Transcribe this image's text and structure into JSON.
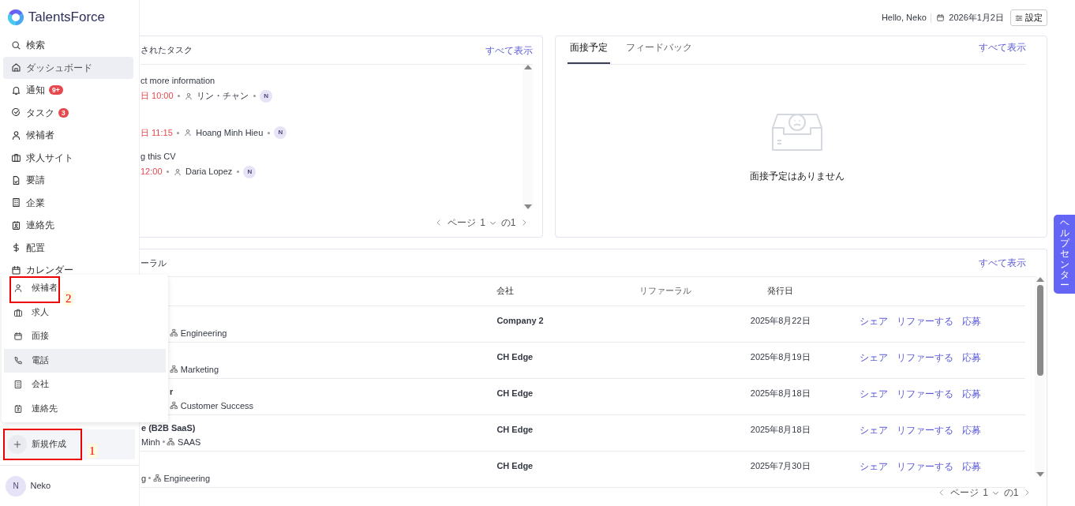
{
  "sidebar": {
    "logo": "TalentsForce",
    "items": [
      {
        "label": "検索",
        "kind": "search",
        "selected": false
      },
      {
        "label": "ダッシュボード",
        "kind": "home",
        "selected": true
      },
      {
        "label": "通知",
        "kind": "bell",
        "selected": false,
        "badge": "9+"
      },
      {
        "label": "タスク",
        "kind": "check",
        "selected": false,
        "badge": "3"
      },
      {
        "label": "候補者",
        "kind": "person",
        "selected": false
      },
      {
        "label": "求人サイト",
        "kind": "briefcase",
        "selected": false
      },
      {
        "label": "要請",
        "kind": "document",
        "selected": false
      },
      {
        "label": "企業",
        "kind": "building",
        "selected": false
      },
      {
        "label": "連絡先",
        "kind": "contact",
        "selected": false
      },
      {
        "label": "配置",
        "kind": "dollar",
        "selected": false
      },
      {
        "label": "カレンダー",
        "kind": "calendar",
        "selected": false
      }
    ],
    "create_button": "新規作成",
    "user": {
      "initial": "N",
      "name": "Neko"
    }
  },
  "create_menu": {
    "items": [
      {
        "label": "候補者",
        "kind": "person",
        "highlighted": false
      },
      {
        "label": "求人",
        "kind": "briefcase",
        "highlighted": false
      },
      {
        "label": "面接",
        "kind": "calendar",
        "highlighted": false
      },
      {
        "label": "電話",
        "kind": "phone",
        "highlighted": true
      },
      {
        "label": "会社",
        "kind": "building",
        "highlighted": false
      },
      {
        "label": "連絡先",
        "kind": "contact",
        "highlighted": false
      }
    ]
  },
  "annotations": [
    {
      "label": "1"
    },
    {
      "label": "2"
    }
  ],
  "header": {
    "greeting": "Hello, Neko",
    "date": "2026年1月2日",
    "settings_button": "設定"
  },
  "tasks_card": {
    "title": "されたタスク",
    "view_all": "すべて表示",
    "tasks": [
      {
        "title": "ct more information",
        "due": "日 10:00",
        "assignee": "リン・チャン",
        "owner_initial": "N"
      },
      {
        "due": "日 11:15",
        "assignee": "Hoang Minh Hieu",
        "owner_initial": "N"
      },
      {
        "title": "g this CV",
        "due": "12:00",
        "assignee": "Daria Lopez",
        "owner_initial": "N"
      }
    ],
    "pagination": {
      "label": "ページ",
      "page": "1",
      "total": "の1"
    }
  },
  "interviews_card": {
    "tabs": [
      {
        "label": "面接予定",
        "selected": true
      },
      {
        "label": "フィードバック",
        "selected": false
      }
    ],
    "view_all": "すべて表示",
    "empty_message": "面接予定はありません"
  },
  "referrals_card": {
    "title": "ーラル",
    "view_all": "すべて表示",
    "columns": [
      "会社",
      "リファーラル",
      "発行日"
    ],
    "rows": [
      {
        "department": "Engineering",
        "company": "Company 2",
        "date": "2025年8月22日",
        "actions": [
          "シェア",
          "リファーする",
          "応募"
        ]
      },
      {
        "department": "Marketing",
        "company": "CH Edge",
        "date": "2025年8月19日",
        "actions": [
          "シェア",
          "リファーする",
          "応募"
        ]
      },
      {
        "title": "r",
        "department": "Customer Success",
        "company": "CH Edge",
        "date": "2025年8月18日",
        "actions": [
          "シェア",
          "リファーする",
          "応募"
        ]
      },
      {
        "title": "e (B2B SaaS)",
        "owner": "Minh",
        "department": "SAAS",
        "company": "CH Edge",
        "date": "2025年8月18日",
        "actions": [
          "シェア",
          "リファーする",
          "応募"
        ]
      },
      {
        "owner": "g",
        "department": "Engineering",
        "company": "CH Edge",
        "date": "2025年7月30日",
        "actions": [
          "シェア",
          "リファーする",
          "応募"
        ]
      }
    ],
    "pagination": {
      "label": "ページ",
      "page": "1",
      "total": "の1"
    }
  },
  "help_tab": "ヘルプセンター"
}
